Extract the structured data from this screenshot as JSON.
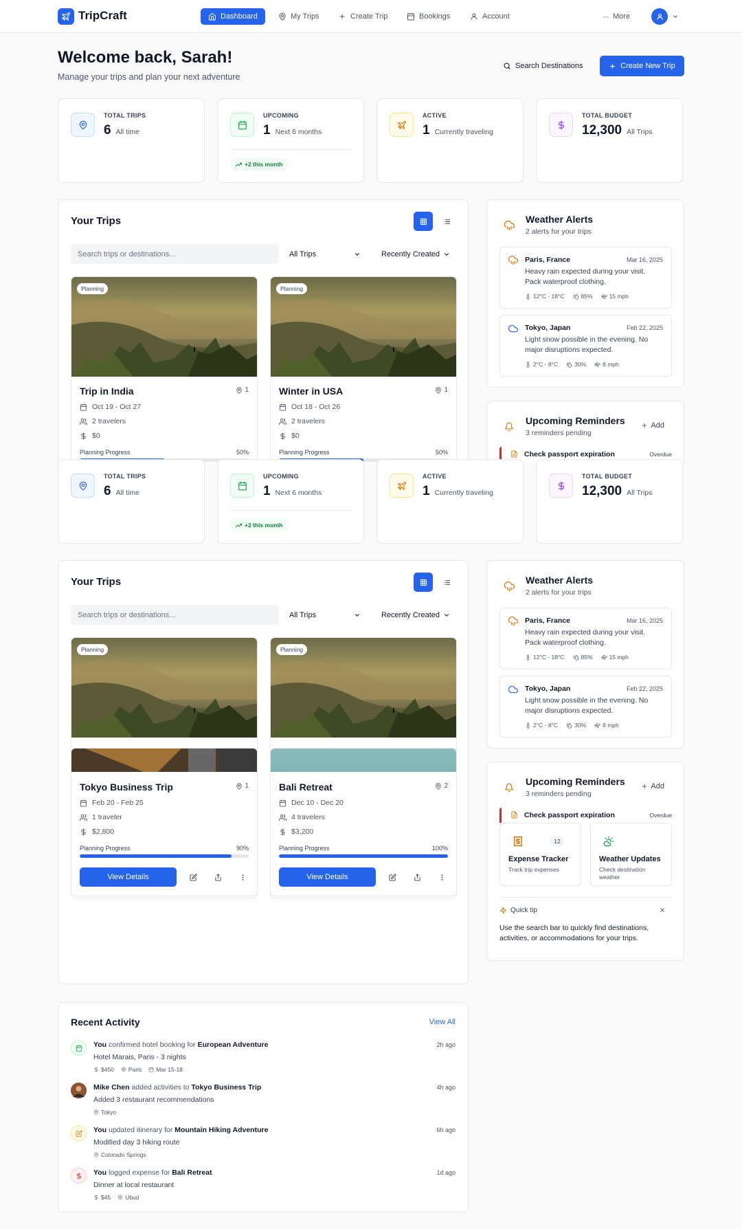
{
  "brand": {
    "name": "TripCraft"
  },
  "nav": {
    "items": [
      {
        "label": "Dashboard",
        "icon": "home-icon"
      },
      {
        "label": "My Trips",
        "icon": "map-pin-icon"
      },
      {
        "label": "Create Trip",
        "icon": "plus-icon"
      },
      {
        "label": "Bookings",
        "icon": "calendar-icon"
      },
      {
        "label": "Account",
        "icon": "user-icon"
      }
    ],
    "more_label": "More"
  },
  "header": {
    "welcome": "Welcome back, Sarah!",
    "subtitle": "Manage your trips and plan your next adventure",
    "search_label": "Search Destinations",
    "create_label": "Create New Trip"
  },
  "stats": [
    {
      "label": "TOTAL TRIPS",
      "value": "6",
      "sub": "All time",
      "icon": "map-pin-icon",
      "color": "#2563eb"
    },
    {
      "label": "UPCOMING",
      "value": "1",
      "sub": "Next 6 months",
      "icon": "calendar-icon",
      "color": "#16a34a",
      "badge": "+2 this month"
    },
    {
      "label": "ACTIVE",
      "value": "1",
      "sub": "Currently traveling",
      "icon": "plane-icon",
      "color": "#d97706"
    },
    {
      "label": "TOTAL BUDGET",
      "value": "12,300",
      "sub": "All Trips",
      "icon": "dollar-icon",
      "color": "#9333ea"
    }
  ],
  "trips_panel": {
    "title": "Your Trips",
    "search_placeholder": "Search trips or destinations...",
    "filter_value": "All Trips",
    "sort_value": "Recently Created",
    "progress_label": "Planning Progress",
    "view_details": "View Details"
  },
  "trips": [
    {
      "title": "Trip in India",
      "badge": "Planning",
      "locations": "1",
      "dates": "Oct 19 - Oct 27",
      "travelers": "2 travelers",
      "budget": "$0",
      "progress": 50,
      "progress_text": "50%"
    },
    {
      "title": "Winter in USA",
      "badge": "Planning",
      "locations": "1",
      "dates": "Oct 18 - Oct 26",
      "travelers": "2 travelers",
      "budget": "$0",
      "progress": 50,
      "progress_text": "50%"
    },
    {
      "title": "Tokyo Business Trip",
      "locations": "1",
      "dates": "Feb 20 - Feb 25",
      "travelers": "1 traveler",
      "budget": "$2,800",
      "progress": 90,
      "progress_text": "90%"
    },
    {
      "title": "Bali Retreat",
      "locations": "2",
      "dates": "Dec 10 - Dec 20",
      "travelers": "4 travelers",
      "budget": "$3,200",
      "progress": 100,
      "progress_text": "100%"
    }
  ],
  "weather": {
    "title": "Weather Alerts",
    "sub": "2 alerts for your trips",
    "alerts": [
      {
        "city": "Paris, France",
        "date": "Mar 16, 2025",
        "text": "Heavy rain expected during your visit. Pack waterproof clothing.",
        "temp": "12°C - 18°C",
        "humidity": "85%",
        "wind": "15 mph",
        "icon": "rain-cloud-icon",
        "color": "#d97706"
      },
      {
        "city": "Tokyo, Japan",
        "date": "Feb 22, 2025",
        "text": "Light snow possible in the evening. No major disruptions expected.",
        "temp": "2°C - 8°C",
        "humidity": "30%",
        "wind": "8 mph",
        "icon": "cloud-icon",
        "color": "#2563eb"
      }
    ]
  },
  "reminders": {
    "title": "Upcoming Reminders",
    "sub": "3 reminders pending",
    "add_label": "Add",
    "first": {
      "text": "Check passport expiration",
      "status": "Overdue"
    }
  },
  "features": [
    {
      "title": "Expense Tracker",
      "sub": "Track trip expenses",
      "count": "12",
      "icon": "receipt-icon"
    },
    {
      "title": "Weather Updates",
      "sub": "Check destination weather",
      "icon": "sun-cloud-icon"
    }
  ],
  "tip": {
    "label": "Quick tip",
    "text": "Use the search bar to quickly find destinations, activities, or accommodations for your trips."
  },
  "activity": {
    "title": "Recent Activity",
    "view_all": "View All",
    "items": [
      {
        "actor": "You",
        "action": " confirmed hotel booking for ",
        "target": "European Adventure",
        "detail": "Hotel Marais, Paris - 3 nights",
        "meta": [
          "$450",
          "Paris",
          "Mar 15-18"
        ],
        "time": "2h ago",
        "icon": "calendar-icon"
      },
      {
        "actor": "Mike Chen",
        "action": " added activities to ",
        "target": "Tokyo Business Trip",
        "detail": "Added 3 restaurant recommendations",
        "meta": [
          "Tokyo"
        ],
        "time": "4h ago",
        "icon": "avatar"
      },
      {
        "actor": "You",
        "action": " updated itinerary for ",
        "target": "Mountain Hiking Adventure",
        "detail": "Modified day 3 hiking route",
        "meta": [
          "Colorado Springs"
        ],
        "time": "6h ago",
        "icon": "edit-icon"
      },
      {
        "actor": "You",
        "action": " logged expense for ",
        "target": "Bali Retreat",
        "detail": "Dinner at local restaurant",
        "meta": [
          "$45",
          "Ubud"
        ],
        "time": "1d ago",
        "icon": "dollar-icon"
      }
    ]
  }
}
